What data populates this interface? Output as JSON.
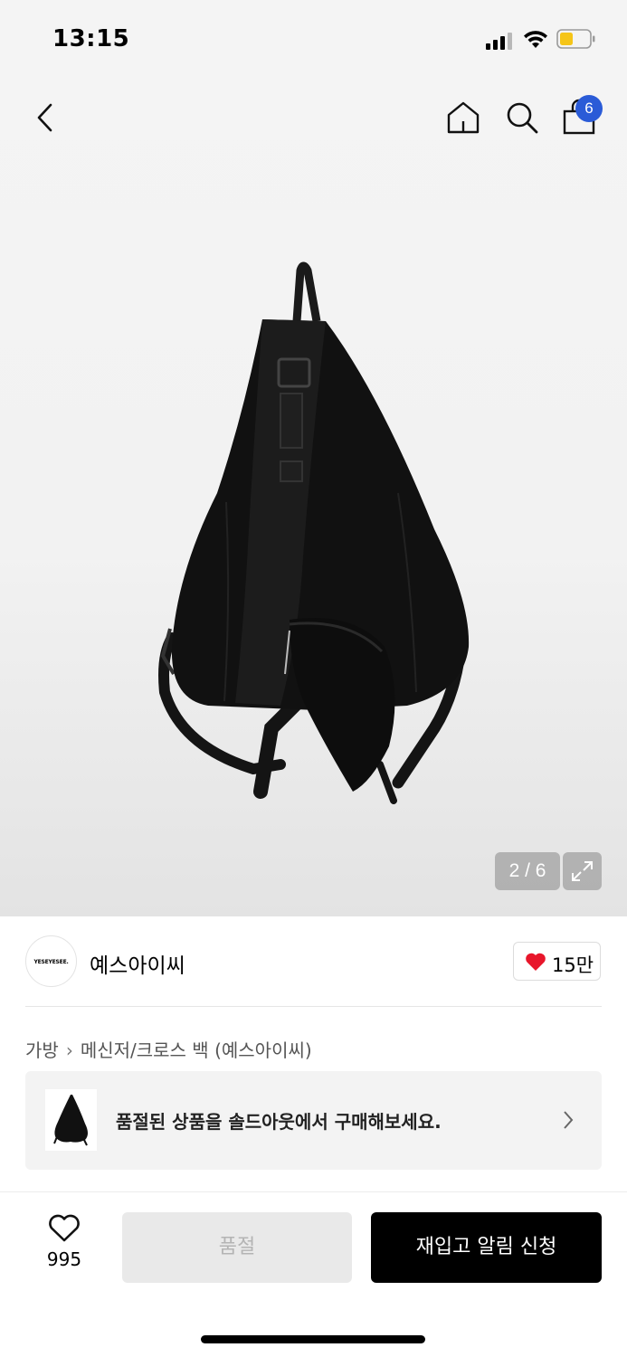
{
  "status_bar": {
    "time": "13:15"
  },
  "nav": {
    "cart_count": "6"
  },
  "gallery": {
    "counter": "2 / 6"
  },
  "brand": {
    "logo_text": "YESEYESEE.",
    "name": "예스아이씨",
    "likes": "15만",
    "heart_color": "#e8162b"
  },
  "breadcrumb": {
    "category": "가방",
    "sub_category": "메신저/크로스 백 (예스아이씨)"
  },
  "soldout_banner": {
    "text": "품절된 상품을 솔드아웃에서 구매해보세요."
  },
  "bottom_bar": {
    "wish_count": "995",
    "soldout_label": "품절",
    "restock_label": "재입고 알림 신청"
  },
  "colors": {
    "badge": "#2a5bd7",
    "primary_button": "#000000",
    "disabled_button": "#e9e9e9"
  }
}
